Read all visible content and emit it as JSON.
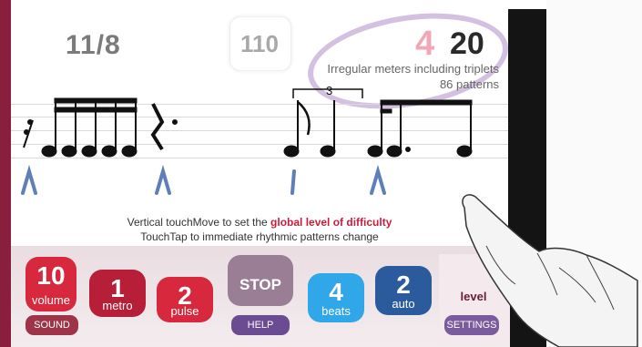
{
  "header": {
    "meter": "11/8",
    "tempo": "110",
    "level_number": "4",
    "total_levels": "20",
    "mode_title": "Irregular meters including triplets",
    "patterns": "86 patterns"
  },
  "staff": {
    "triplet_number": "3"
  },
  "hint": {
    "line1_before": "Vertical touchMove to set the ",
    "line1_highlight": "global level of difficulty",
    "line2": "TouchTap to immediate rhythmic patterns change"
  },
  "controls": {
    "volume": {
      "value": "10",
      "label": "volume"
    },
    "metro": {
      "value": "1",
      "label": "metro"
    },
    "pulse": {
      "value": "2",
      "label": "pulse"
    },
    "stop": {
      "label": "STOP"
    },
    "beats": {
      "value": "4",
      "label": "beats"
    },
    "auto": {
      "value": "2",
      "label": "auto"
    },
    "level": {
      "label": "level"
    },
    "sound_button": "SOUND",
    "help_button": "HELP",
    "settings_button": "SETTINGS"
  },
  "colors": {
    "accent_red": "#d8283d",
    "sky": "#30a7e8",
    "navy": "#2c5b9d",
    "highlight": "#c81e3e"
  }
}
